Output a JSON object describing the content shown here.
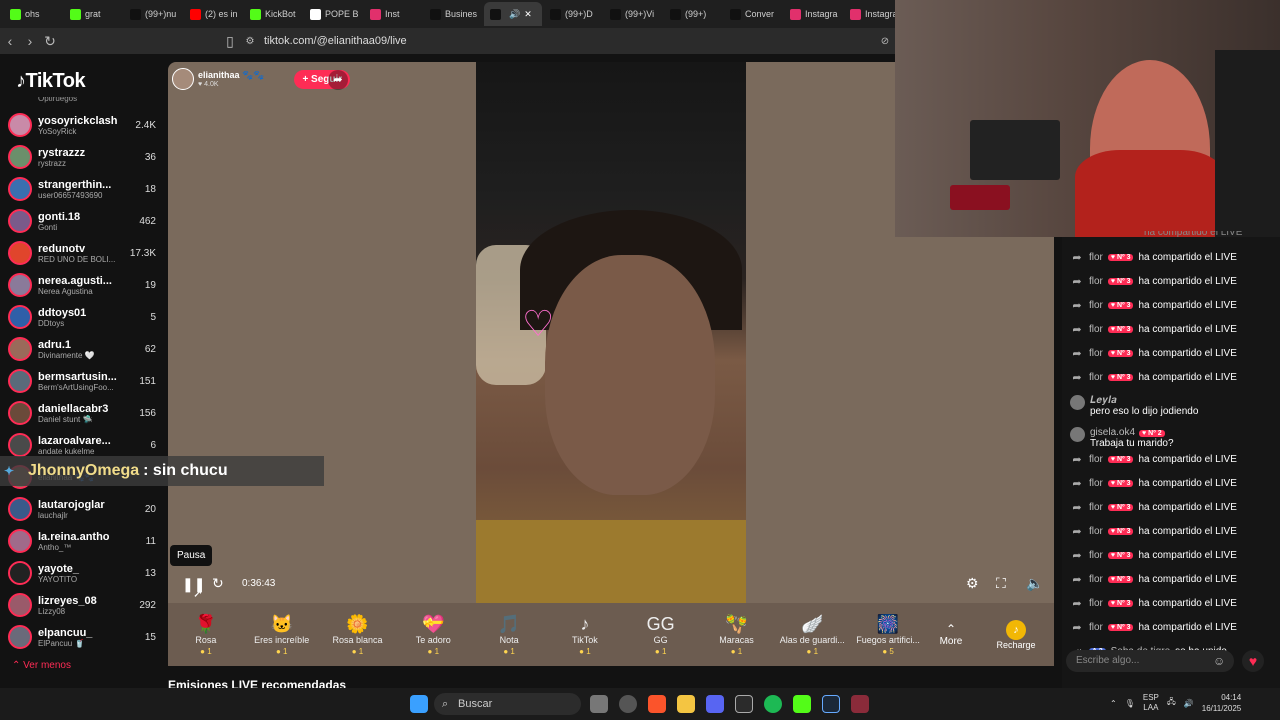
{
  "browser": {
    "tabs": [
      {
        "label": "ohs",
        "color": "#53fc18"
      },
      {
        "label": "grat",
        "color": "#53fc18"
      },
      {
        "label": "(99+)nu",
        "color": "#111111"
      },
      {
        "label": "(2) es in",
        "color": "#ff0000"
      },
      {
        "label": "KickBot",
        "color": "#53fc18"
      },
      {
        "label": "POPE B",
        "color": "#ffffff"
      },
      {
        "label": "Inst",
        "color": "#e1306c"
      },
      {
        "label": "Busines",
        "color": "#111111"
      },
      {
        "label": "",
        "color": "#111111"
      },
      {
        "label": "(99+)D",
        "color": "#111111"
      },
      {
        "label": "(99+)Vi",
        "color": "#111111"
      },
      {
        "label": "(99+)",
        "color": "#111111"
      },
      {
        "label": "Conver",
        "color": "#111111"
      },
      {
        "label": "Instagra",
        "color": "#e1306c"
      },
      {
        "label": "Instagra",
        "color": "#e1306c"
      }
    ],
    "url": "tiktok.com/@elianithaa09/live"
  },
  "sidebar": {
    "logo": "TikTok",
    "top_cut": "Optiruegos",
    "items": [
      {
        "name": "yosoyrickclash",
        "sub": "YoSoyRick",
        "count": "2.4K",
        "color": "#c98aa8"
      },
      {
        "name": "rystrazzz",
        "sub": "rystrazz",
        "count": "36",
        "color": "#6b8f6b"
      },
      {
        "name": "strangerthin...",
        "sub": "user06657493690",
        "count": "18",
        "color": "#3a6fb0"
      },
      {
        "name": "gonti.18",
        "sub": "Gonti",
        "count": "462",
        "color": "#7a5a8a"
      },
      {
        "name": "redunotv",
        "sub": "RED UNO DE BOLI...",
        "count": "17.3K",
        "color": "#e0452c"
      },
      {
        "name": "nerea.agusti...",
        "sub": "Nerea Agustina",
        "count": "19",
        "color": "#8a7a9a"
      },
      {
        "name": "ddtoys01",
        "sub": "DDtoys",
        "count": "5",
        "color": "#2f5fa8"
      },
      {
        "name": "adru.1",
        "sub": "Divinamente 🤍",
        "count": "62",
        "color": "#9a6a5a"
      },
      {
        "name": "bermsartusin...",
        "sub": "Berm'sArtUsingFoo...",
        "count": "151",
        "color": "#5a6a7a"
      },
      {
        "name": "daniellacabr3",
        "sub": "Daniel stunt 🛸",
        "count": "156",
        "color": "#6a4a3a"
      },
      {
        "name": "lazaroalvare...",
        "sub": "andate kukelme",
        "count": "6",
        "color": "#4a4a4a"
      },
      {
        "name": "",
        "sub": "elianithaa 🐾🐾",
        "count": "",
        "color": "#8a6a5a"
      },
      {
        "name": "lautarojoglar",
        "sub": "lauchajlr",
        "count": "20",
        "color": "#3a5a8a"
      },
      {
        "name": "la.reina.antho",
        "sub": "Antho_™",
        "count": "11",
        "color": "#a06a8a"
      },
      {
        "name": "yayote_",
        "sub": "YAYOTITO",
        "count": "13",
        "color": "#222222"
      },
      {
        "name": "lizreyes_08",
        "sub": "Lizzy08",
        "count": "292",
        "color": "#9a5a6a"
      },
      {
        "name": "elpancuu_",
        "sub": "ElPancuu 🥤",
        "count": "15",
        "color": "#6a6a7a"
      }
    ],
    "see_less": "Ver menos"
  },
  "player": {
    "host_name": "elianithaa 🐾🐾",
    "host_likes": "♥ 4.0K",
    "follow_label": "+ Seguir",
    "overlay_user": "JhonnyOmega",
    "overlay_msg": ": sin chucu",
    "tooltip": "Pausa",
    "timer": "0:36:43",
    "heart": "♡"
  },
  "gifts": [
    {
      "name": "Rosa",
      "icon": "🌹",
      "price": "1"
    },
    {
      "name": "Eres increíble",
      "icon": "🐱",
      "price": "1"
    },
    {
      "name": "Rosa blanca",
      "icon": "🌼",
      "price": "1"
    },
    {
      "name": "Te adoro",
      "icon": "💝",
      "price": "1"
    },
    {
      "name": "Nota",
      "icon": "🎵",
      "price": "1"
    },
    {
      "name": "TikTok",
      "icon": "♪",
      "price": "1"
    },
    {
      "name": "GG",
      "icon": "GG",
      "price": "1"
    },
    {
      "name": "Maracas",
      "icon": "🪇",
      "price": "1"
    },
    {
      "name": "Alas de guardi...",
      "icon": "🪽",
      "price": "1"
    },
    {
      "name": "Fuegos artifici...",
      "icon": "🎆",
      "price": "5"
    }
  ],
  "gifts_more": "More",
  "recharge": "Recharge",
  "recommended_title": "Emisiones LIVE recomendadas",
  "chat": {
    "rows": [
      {
        "type": "share",
        "user": "flor",
        "badge": "♥ Nº 3",
        "text": "ha compartido el LIVE"
      },
      {
        "type": "share",
        "user": "flor",
        "badge": "♥ Nº 3",
        "text": "ha compartido el LIVE"
      },
      {
        "type": "share",
        "user": "flor",
        "badge": "♥ Nº 3",
        "text": "ha compartido el LIVE"
      },
      {
        "type": "share",
        "user": "flor",
        "badge": "♥ Nº 3",
        "text": "ha compartido el LIVE"
      },
      {
        "type": "share",
        "user": "flor",
        "badge": "♥ Nº 3",
        "text": "ha compartido el LIVE"
      },
      {
        "type": "share",
        "user": "flor",
        "badge": "♥ Nº 3",
        "text": "ha compartido el LIVE"
      },
      {
        "type": "msg",
        "user": "𝑳𝒆𝒚𝒍𝒂",
        "badge": "",
        "text": "pero eso lo dijo jodiendo"
      },
      {
        "type": "msg",
        "user": "gisela.ok4",
        "badge": "♥ Nº 2",
        "text": "Trabaja tu marido?"
      },
      {
        "type": "share",
        "user": "flor",
        "badge": "♥ Nº 3",
        "text": "ha compartido el LIVE"
      },
      {
        "type": "share",
        "user": "flor",
        "badge": "♥ Nº 3",
        "text": "ha compartido el LIVE"
      },
      {
        "type": "share",
        "user": "flor",
        "badge": "♥ Nº 3",
        "text": "ha compartido el LIVE"
      },
      {
        "type": "share",
        "user": "flor",
        "badge": "♥ Nº 3",
        "text": "ha compartido el LIVE"
      },
      {
        "type": "share",
        "user": "flor",
        "badge": "♥ Nº 3",
        "text": "ha compartido el LIVE"
      },
      {
        "type": "share",
        "user": "flor",
        "badge": "♥ Nº 3",
        "text": "ha compartido el LIVE"
      },
      {
        "type": "share",
        "user": "flor",
        "badge": "♥ Nº 3",
        "text": "ha compartido el LIVE"
      },
      {
        "type": "share",
        "user": "flor",
        "badge": "♥ Nº 3",
        "text": "ha compartido el LIVE"
      },
      {
        "type": "join",
        "user": "Seba de tigre",
        "badge": "A 2",
        "text": "se ha unido"
      }
    ],
    "top_cut": "ha compartido el LIVE",
    "placeholder": "Escribe algo..."
  },
  "taskbar": {
    "search": "Buscar",
    "lang": "ESP",
    "lang2": "LAA",
    "time": "04:14",
    "date": "16/11/2025"
  }
}
